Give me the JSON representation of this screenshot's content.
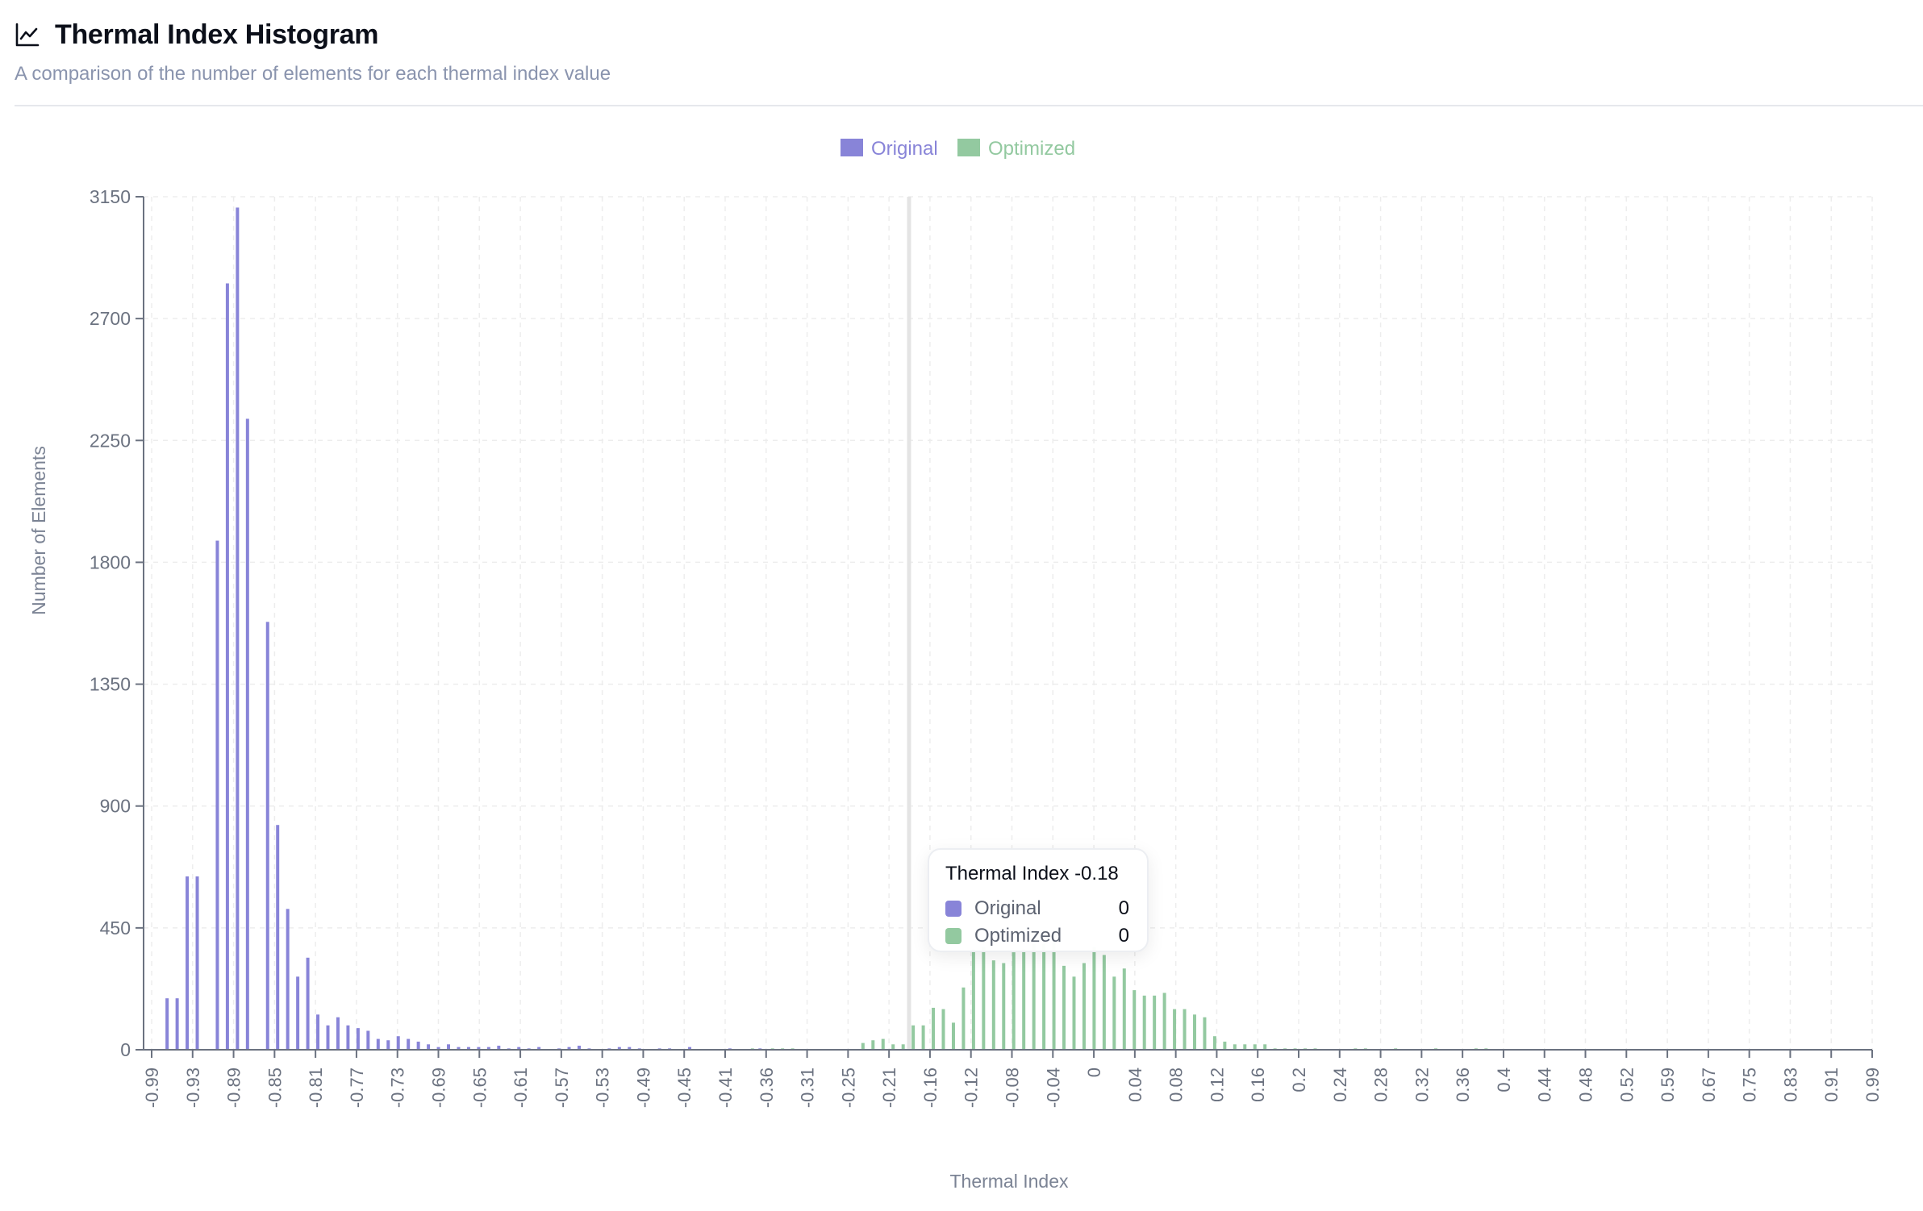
{
  "header": {
    "title": "Thermal Index Histogram",
    "subtitle": "A comparison of the number of elements for each thermal index value",
    "icon": "line-chart-icon"
  },
  "tooltip": {
    "title": "Thermal Index -0.18",
    "rows": [
      {
        "label": "Original",
        "value": "0",
        "color": "#8884d8"
      },
      {
        "label": "Optimized",
        "value": "0",
        "color": "#93c9a0"
      }
    ]
  },
  "colors": {
    "original": "#8884d8",
    "optimized": "#93c9a0",
    "grid": "#ececec",
    "axis": "#6b7280"
  },
  "chart_data": {
    "type": "bar",
    "title": "Thermal Index Histogram",
    "subtitle": "A comparison of the number of elements for each thermal index value",
    "xlabel": "Thermal Index",
    "ylabel": "Number of Elements",
    "ylim": [
      0,
      3150
    ],
    "yticks": [
      0,
      450,
      900,
      1350,
      1800,
      2250,
      2700,
      3150
    ],
    "xticks": [
      "-0.99",
      "-0.93",
      "-0.89",
      "-0.85",
      "-0.81",
      "-0.77",
      "-0.73",
      "-0.69",
      "-0.65",
      "-0.61",
      "-0.57",
      "-0.53",
      "-0.49",
      "-0.45",
      "-0.41",
      "-0.36",
      "-0.31",
      "-0.25",
      "-0.21",
      "-0.16",
      "-0.12",
      "-0.08",
      "-0.04",
      "0",
      "0.04",
      "0.08",
      "0.12",
      "0.16",
      "0.2",
      "0.24",
      "0.28",
      "0.32",
      "0.36",
      "0.4",
      "0.44",
      "0.48",
      "0.52",
      "0.59",
      "0.67",
      "0.75",
      "0.83",
      "0.91",
      "0.99"
    ],
    "grid": true,
    "legend": "top-center",
    "highlight_category_index": 73,
    "series": [
      {
        "name": "Original",
        "color": "#8884d8",
        "values": [
          0,
          0,
          190,
          190,
          640,
          640,
          0,
          1880,
          2830,
          3110,
          2330,
          0,
          1580,
          830,
          520,
          270,
          340,
          130,
          90,
          120,
          90,
          80,
          70,
          40,
          35,
          50,
          40,
          30,
          20,
          10,
          20,
          10,
          10,
          10,
          10,
          15,
          5,
          10,
          5,
          10,
          0,
          5,
          10,
          15,
          5,
          0,
          5,
          10,
          10,
          5,
          0,
          5,
          5,
          0,
          10,
          0,
          0,
          0,
          5,
          0,
          0,
          5,
          0,
          0,
          0,
          0,
          0,
          0,
          0,
          0,
          0,
          0,
          0,
          0,
          0,
          0,
          0,
          0,
          0,
          0,
          0,
          0,
          0,
          0,
          0,
          0,
          0,
          0,
          0,
          0,
          0,
          0,
          0,
          0,
          0,
          0,
          0,
          0,
          0,
          0,
          0,
          0,
          0,
          0,
          0,
          0,
          0,
          0,
          0,
          0,
          0,
          0,
          0,
          0,
          0,
          0,
          0,
          0,
          0,
          0,
          0,
          0,
          0,
          0,
          0,
          0,
          0,
          0,
          0,
          0,
          0,
          0,
          0,
          0,
          0,
          0,
          0,
          0,
          0,
          0,
          0,
          0,
          0,
          0,
          0,
          0,
          0,
          0,
          0,
          0,
          0,
          0,
          0,
          0,
          0,
          0,
          0,
          0,
          0,
          0,
          0,
          0,
          0,
          0,
          0,
          0,
          0,
          0,
          0,
          0,
          0,
          0
        ]
      },
      {
        "name": "Optimized",
        "color": "#93c9a0",
        "values": [
          0,
          0,
          0,
          0,
          0,
          0,
          0,
          0,
          0,
          0,
          0,
          0,
          0,
          0,
          0,
          0,
          0,
          0,
          0,
          0,
          0,
          0,
          0,
          0,
          0,
          0,
          0,
          0,
          0,
          0,
          0,
          0,
          0,
          0,
          0,
          0,
          0,
          0,
          0,
          0,
          0,
          0,
          0,
          0,
          0,
          0,
          0,
          0,
          0,
          0,
          0,
          0,
          0,
          0,
          0,
          0,
          0,
          0,
          0,
          0,
          5,
          0,
          5,
          5,
          5,
          0,
          0,
          0,
          0,
          0,
          0,
          25,
          35,
          40,
          20,
          20,
          90,
          90,
          155,
          150,
          100,
          230,
          370,
          380,
          330,
          320,
          360,
          370,
          390,
          390,
          400,
          310,
          270,
          320,
          380,
          350,
          270,
          300,
          220,
          200,
          200,
          210,
          150,
          150,
          130,
          120,
          50,
          30,
          20,
          20,
          20,
          20,
          5,
          5,
          5,
          5,
          5,
          0,
          0,
          0,
          5,
          5,
          0,
          0,
          5,
          0,
          0,
          0,
          5,
          0,
          0,
          0,
          5,
          5,
          0,
          0,
          0,
          0,
          0,
          0,
          0,
          0,
          0,
          0,
          0,
          0,
          0,
          0,
          0,
          0,
          0,
          0,
          0,
          0,
          0,
          0,
          0,
          0,
          0,
          0,
          0,
          0,
          0,
          0,
          0,
          0,
          0,
          0,
          0,
          0,
          0
        ]
      }
    ]
  }
}
